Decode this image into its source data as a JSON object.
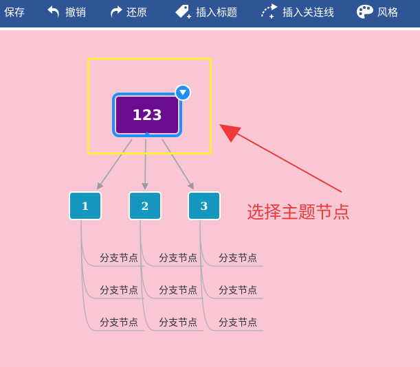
{
  "toolbar": {
    "save": "保存",
    "undo": "撤销",
    "redo": "还原",
    "insert_topic": "插入标题",
    "insert_connector": "插入关连线",
    "style": "风格"
  },
  "mindmap": {
    "root": "123",
    "children": [
      "1",
      "2",
      "3"
    ],
    "branch_label": "分支节点"
  },
  "annotation": "选择主题节点",
  "colors": {
    "toolbar": "#2f5597",
    "background": "#f9c6d3",
    "root_node": "#6a0c8e",
    "selection_outline": "#1e90ff",
    "selection_frame": "#ffeb3b",
    "child_node": "#1597c0",
    "annotation": "#ee3a3a"
  },
  "icons": [
    "undo-icon",
    "redo-icon",
    "tag-icon",
    "connector-icon",
    "palette-icon",
    "chevron-down-icon",
    "arrow-icon"
  ]
}
